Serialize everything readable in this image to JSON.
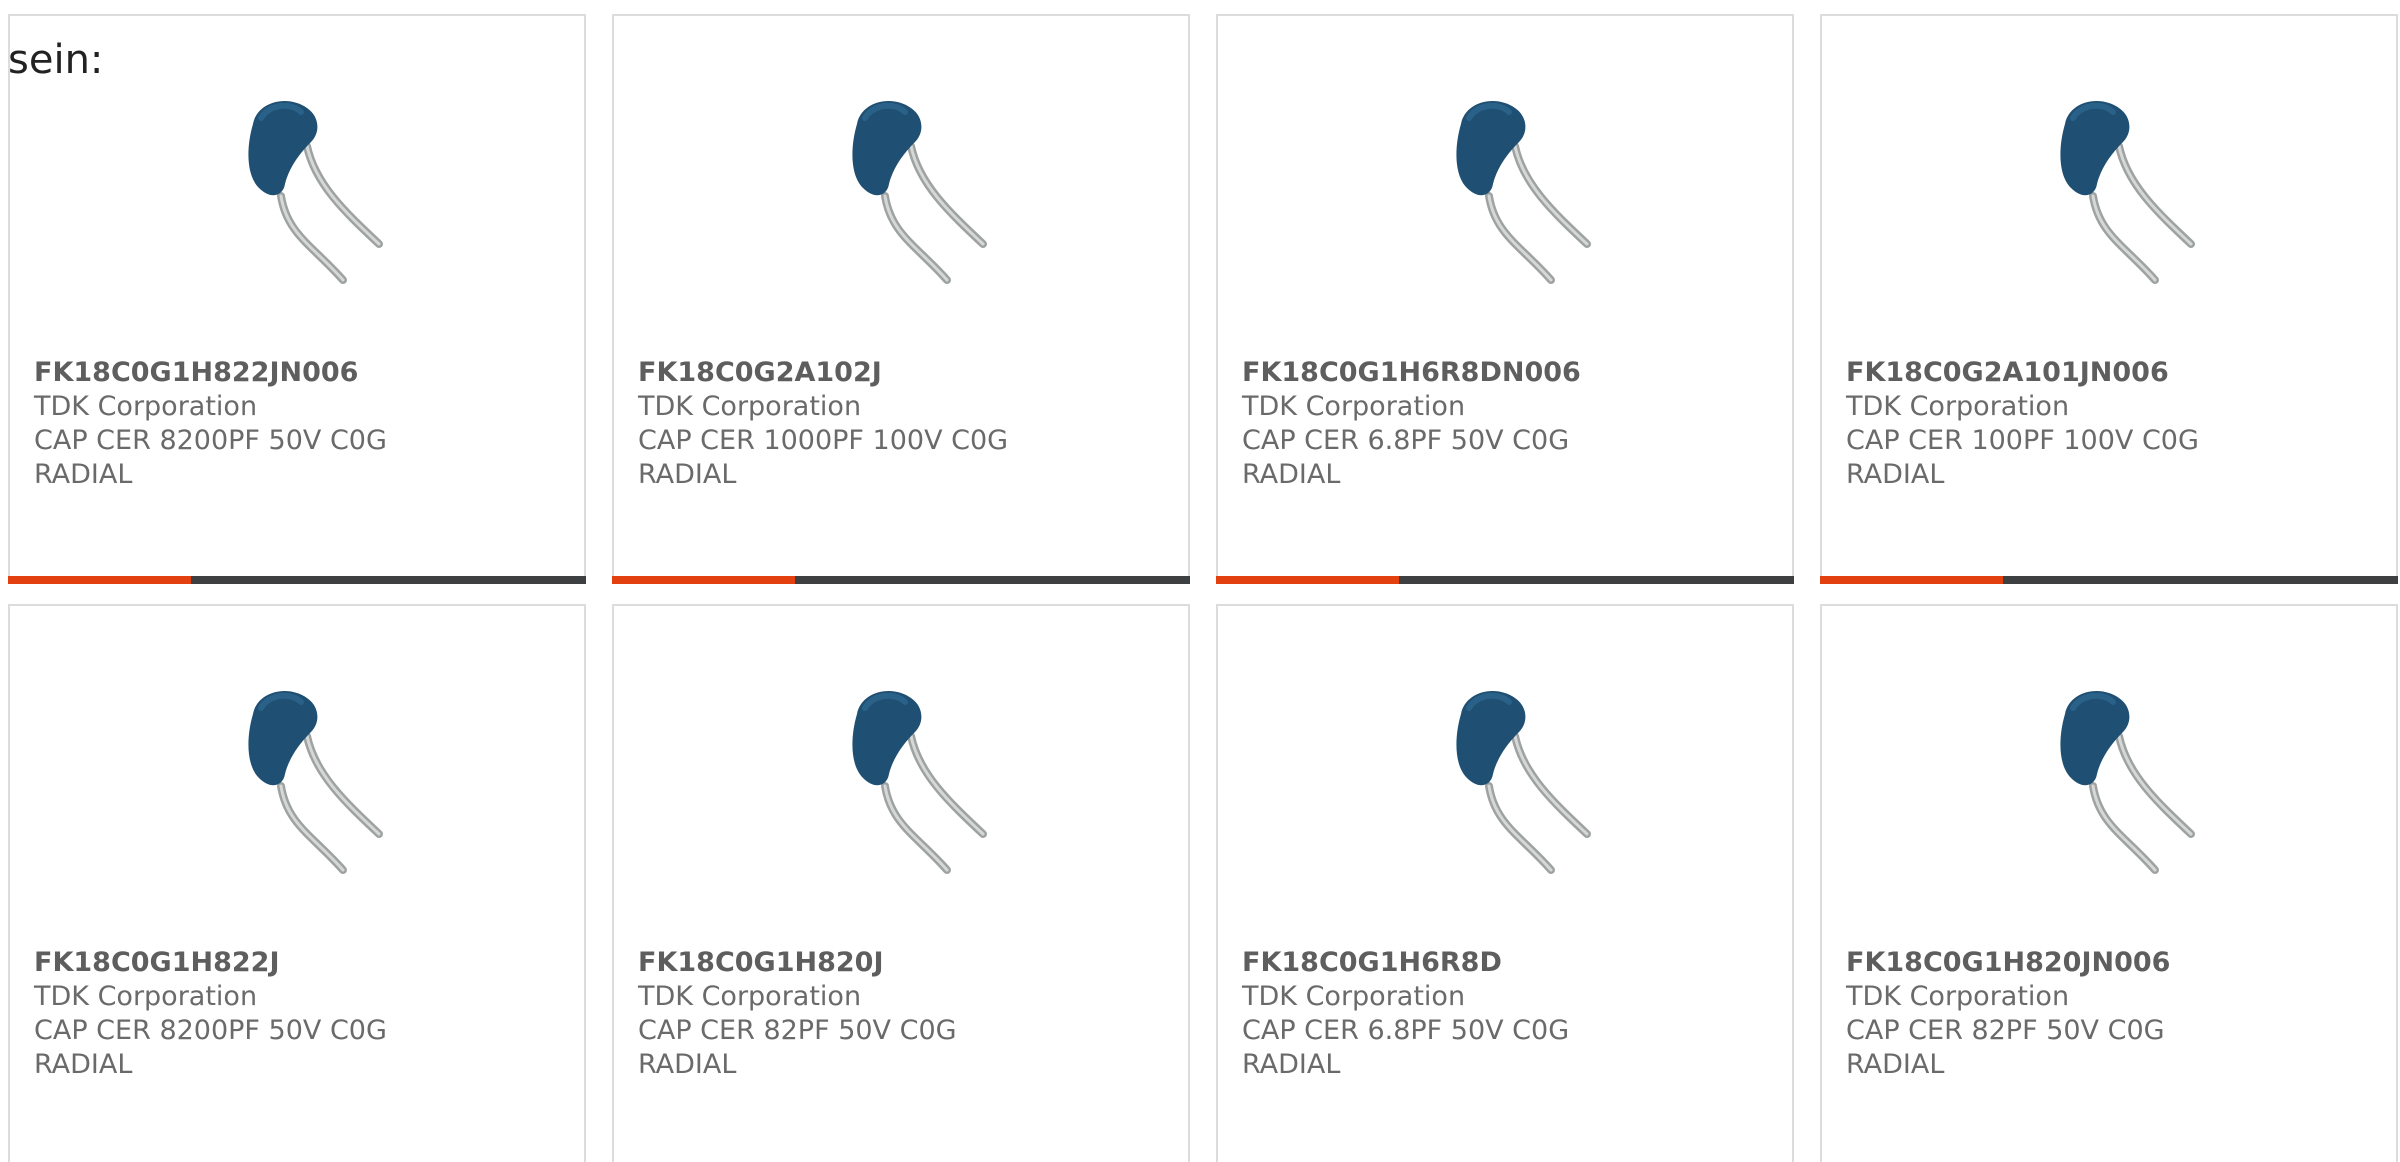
{
  "intro_text": "sein:",
  "colors": {
    "accent": "#e2400e",
    "bar_dark": "#3d3f41",
    "capacitor_body": "#1f4f72",
    "text_gray": "#6a6a6a"
  },
  "icons": {
    "product_image": "ceramic-disc-capacitor-icon"
  },
  "products": [
    {
      "part_number": "FK18C0G1H822JN006",
      "manufacturer": "TDK Corporation",
      "description": "CAP CER 8200PF 50V C0G RADIAL"
    },
    {
      "part_number": "FK18C0G2A102J",
      "manufacturer": "TDK Corporation",
      "description": "CAP CER 1000PF 100V C0G RADIAL"
    },
    {
      "part_number": "FK18C0G1H6R8DN006",
      "manufacturer": "TDK Corporation",
      "description": "CAP CER 6.8PF 50V C0G RADIAL"
    },
    {
      "part_number": "FK18C0G2A101JN006",
      "manufacturer": "TDK Corporation",
      "description": "CAP CER 100PF 100V C0G RADIAL"
    },
    {
      "part_number": "FK18C0G1H822J",
      "manufacturer": "TDK Corporation",
      "description": "CAP CER 8200PF 50V C0G RADIAL"
    },
    {
      "part_number": "FK18C0G1H820J",
      "manufacturer": "TDK Corporation",
      "description": "CAP CER 82PF 50V C0G RADIAL"
    },
    {
      "part_number": "FK18C0G1H6R8D",
      "manufacturer": "TDK Corporation",
      "description": "CAP CER 6.8PF 50V C0G RADIAL"
    },
    {
      "part_number": "FK18C0G1H820JN006",
      "manufacturer": "TDK Corporation",
      "description": "CAP CER 82PF 50V C0G RADIAL"
    }
  ]
}
